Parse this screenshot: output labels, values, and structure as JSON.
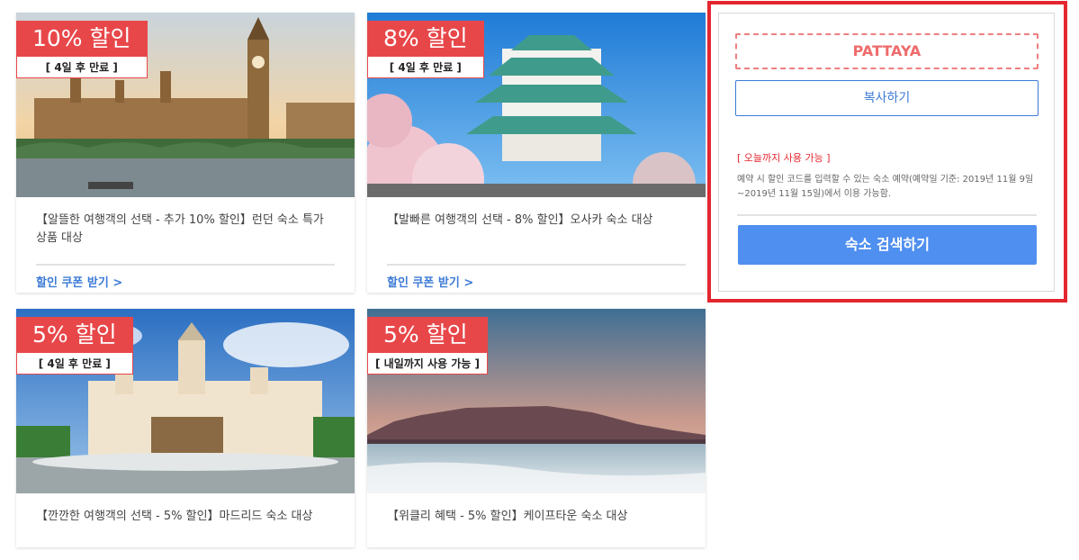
{
  "cards": [
    {
      "discount": "10% 할인",
      "expiry": "[ 4일 후 만료 ]",
      "description": "【알뜰한 여행객의 선택 - 추가 10% 할인】런던 숙소 특가 상품 대상",
      "coupon_link": "할인 쿠폰 받기 >",
      "image": "london-photo"
    },
    {
      "discount": "8% 할인",
      "expiry": "[ 4일 후 만료 ]",
      "description": "【발빠른 여행객의 선택 - 8% 할인】오사카 숙소 대상",
      "coupon_link": "할인 쿠폰 받기 >",
      "image": "osaka-castle-photo"
    },
    {
      "discount": "5% 할인",
      "expiry": "[ 4일 후 만료 ]",
      "description": "【깐깐한 여행객의 선택 - 5% 할인】마드리드 숙소 대상",
      "image": "madrid-photo"
    },
    {
      "discount": "5% 할인",
      "expiry": "[ 내일까지 사용 가능 ]",
      "description": "【위클리 혜택 - 5% 할인】케이프타운 숙소 대상",
      "image": "cape-town-photo"
    }
  ],
  "coupon_panel": {
    "code": "PATTAYA",
    "copy_button": "복사하기",
    "validity": "[ 오늘까지 사용 가능 ]",
    "note": "예약 시 할인 코드를 입력할 수 있는 숙소 예약(예약일 기준: 2019년 11월 9일~2019년 11월 15일)에서 이용 가능함.",
    "search_button": "숙소 검색하기"
  },
  "colors": {
    "badge_red": "#e8474a",
    "link_blue": "#3d7bd6",
    "button_blue": "#4f8ff0",
    "highlight_red": "#e4262f"
  }
}
